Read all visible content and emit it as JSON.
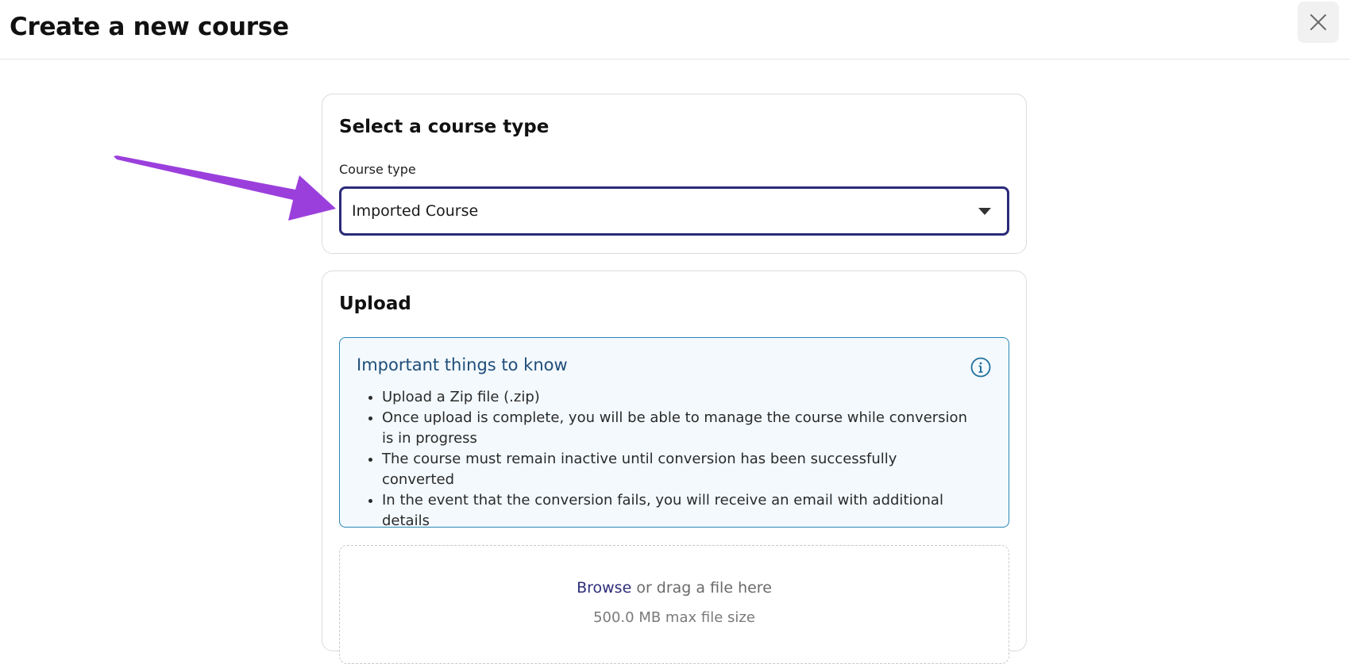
{
  "header": {
    "title": "Create a new course",
    "close_icon": "close-icon"
  },
  "course_type_card": {
    "heading": "Select a course type",
    "field_label": "Course type",
    "selected_value": "Imported Course",
    "caret_icon": "caret-down-icon"
  },
  "upload_card": {
    "heading": "Upload",
    "info": {
      "title": "Important things to know",
      "icon": "info-icon",
      "items": [
        "Upload a Zip file (.zip)",
        "Once upload is complete, you will be able to manage the course while conversion is in progress",
        "The course must remain inactive until conversion has been successfully converted",
        "In the event that the conversion fails, you will receive an email with additional details"
      ]
    },
    "dropzone": {
      "browse_label": "Browse",
      "drag_text": " or drag a file here",
      "max_size": "500.0 MB max file size"
    }
  },
  "annotation": {
    "arrow_color": "#9b3fdc"
  },
  "colors": {
    "select_border": "#2a2a7a",
    "info_border": "#2a86b4",
    "info_background": "#f3f9fd",
    "info_title": "#1f4d7a",
    "browse_link": "#2d2d7a"
  }
}
